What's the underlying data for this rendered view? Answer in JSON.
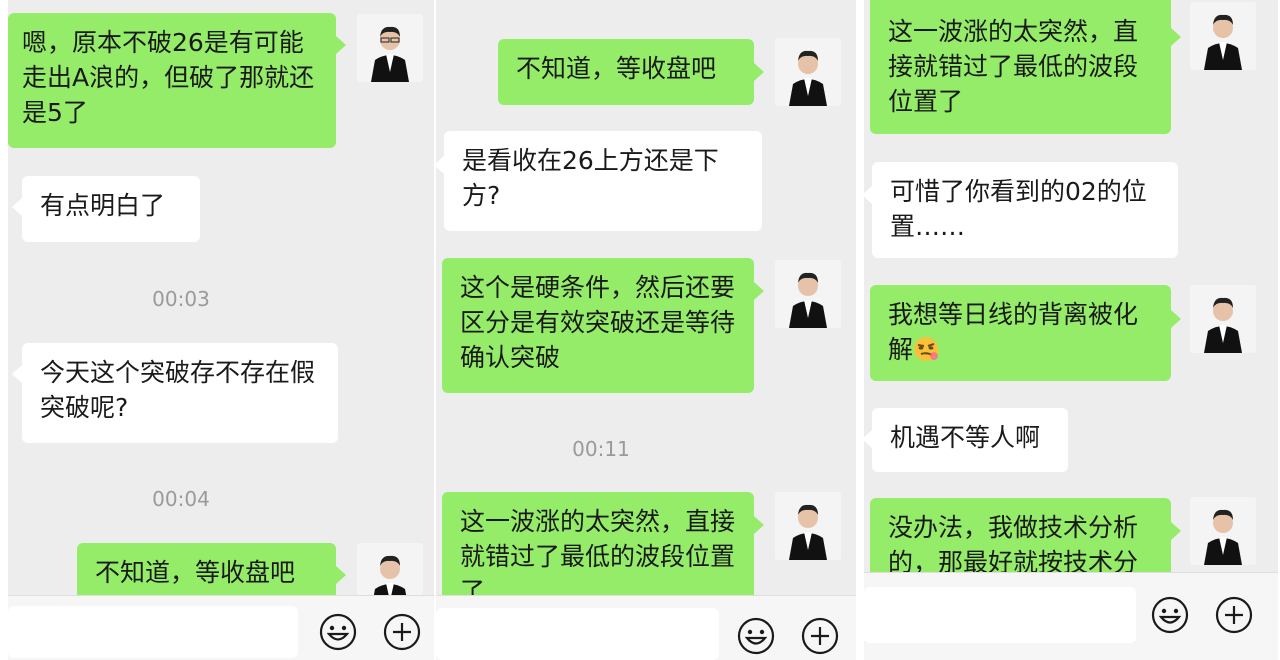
{
  "panel1": {
    "messages": [
      {
        "text": "嗯，原本不破26是有可能走出A浪的，但破了那就还是5了"
      },
      {
        "text": "有点明白了"
      },
      {
        "time": "00:03"
      },
      {
        "text": "今天这个突破存不存在假突破呢?"
      },
      {
        "time": "00:04"
      },
      {
        "text": "不知道，等收盘吧"
      }
    ]
  },
  "panel2": {
    "messages": [
      {
        "text": "不知道，等收盘吧"
      },
      {
        "text": "是看收在26上方还是下方?"
      },
      {
        "text": "这个是硬条件，然后还要区分是有效突破还是等待确认突破"
      },
      {
        "time": "00:11"
      },
      {
        "text": "这一波涨的太突然，直接就错过了最低的波段位置了"
      }
    ]
  },
  "panel3": {
    "messages": [
      {
        "text": "这一波涨的太突然，直接就错过了最低的波段位置了"
      },
      {
        "text": "可惜了你看到的02的位置……"
      },
      {
        "text": "我想等日线的背离被化解"
      },
      {
        "text": "机遇不等人啊"
      },
      {
        "text": "没办法，我做技术分析的，那最好就按技术分"
      }
    ]
  },
  "icons": {
    "emoji_button": "smiley-icon",
    "plus_button": "plus-circle-icon",
    "inline_emoji": "smirk-emoji-icon",
    "avatar": "man-in-suit-avatar"
  },
  "colors": {
    "outgoing_bubble": "#95ec69",
    "incoming_bubble": "#ffffff",
    "background": "#ededed",
    "timestamp": "#9a9a9a"
  }
}
